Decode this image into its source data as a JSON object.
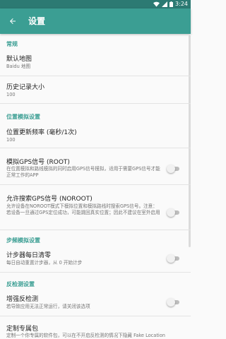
{
  "status_bar": {
    "time": "3:24"
  },
  "app_bar": {
    "title": "设置"
  },
  "sections": {
    "general": "常规",
    "location_sim": "位置模拟设置",
    "step_sim": "步频模拟设置",
    "anti_detect": "反检测设置"
  },
  "prefs": {
    "default_map": {
      "title": "默认地图",
      "summary": "Baidu 地图"
    },
    "history_size": {
      "title": "历史记录大小",
      "summary": "100"
    },
    "update_freq": {
      "title": "位置更新频率 (毫秒/1次)",
      "summary": "100"
    },
    "gps_root": {
      "title": "模拟GPS信号 (ROOT)",
      "summary": "在位置模拟和路线模拟的同时启用GPS信号模拟，适用于需要GPS信号才能正常工作的APP",
      "enabled": false
    },
    "gps_noroot": {
      "title": "允许搜索GPS信号 (NOROOT)",
      "summary": "允许设备在NOROOT模式下模拟位置和模拟路线时搜索GPS信号。注意：若设备一旦通过GPS定位成功，可能跳回真实位置；因此不建议在室外启用",
      "enabled": false
    },
    "step_reset": {
      "title": "计步器每日清零",
      "summary": "每日自动重置计步器，从 0 开始计步",
      "enabled": false
    },
    "enhance_detect": {
      "title": "增强反检测",
      "summary": "若导致应用无法正常运行，请关闭该选项",
      "enabled": false
    },
    "custom_package": {
      "title": "定制专属包",
      "summary": "定制一个你专属的软件包，可以在不开启反检测的情况下隐藏 Fake Location"
    }
  }
}
